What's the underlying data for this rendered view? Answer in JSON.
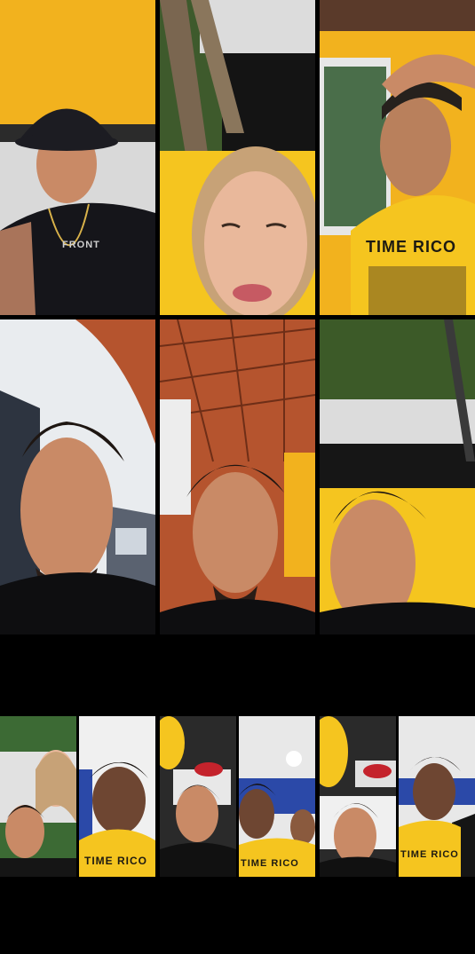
{
  "grid": {
    "tiles": [
      {
        "id": "t1",
        "subject": "man-in-bucket-hat",
        "shirt_text": "FRONT"
      },
      {
        "id": "t2",
        "subject": "woman-blonde",
        "shirt_text": ""
      },
      {
        "id": "t3",
        "subject": "man-yellow-shirt",
        "shirt_text": "TIME RICO"
      },
      {
        "id": "t4",
        "subject": "man-low-angle",
        "shirt_text": ""
      },
      {
        "id": "t5",
        "subject": "man-under-roof",
        "shirt_text": ""
      },
      {
        "id": "t6",
        "subject": "man-lying-yellow-cushion",
        "shirt_text": ""
      }
    ]
  },
  "mini_row": {
    "groups": [
      {
        "id": "g1",
        "left_shirt_text": "",
        "right_shirt_text": "TIME RICO"
      },
      {
        "id": "g2",
        "left_shirt_text": "",
        "right_shirt_text": "TIME RICO"
      },
      {
        "id": "g3",
        "left_shirt_text": "",
        "right_shirt_text": "TIME RICO"
      }
    ]
  },
  "colors": {
    "background": "#000000",
    "brand_yellow": "#f2b21e",
    "shirt_yellow": "#f5c51f",
    "skin": "#c98a66",
    "hair": "#1e1612",
    "roof_orange": "#b5542e"
  }
}
